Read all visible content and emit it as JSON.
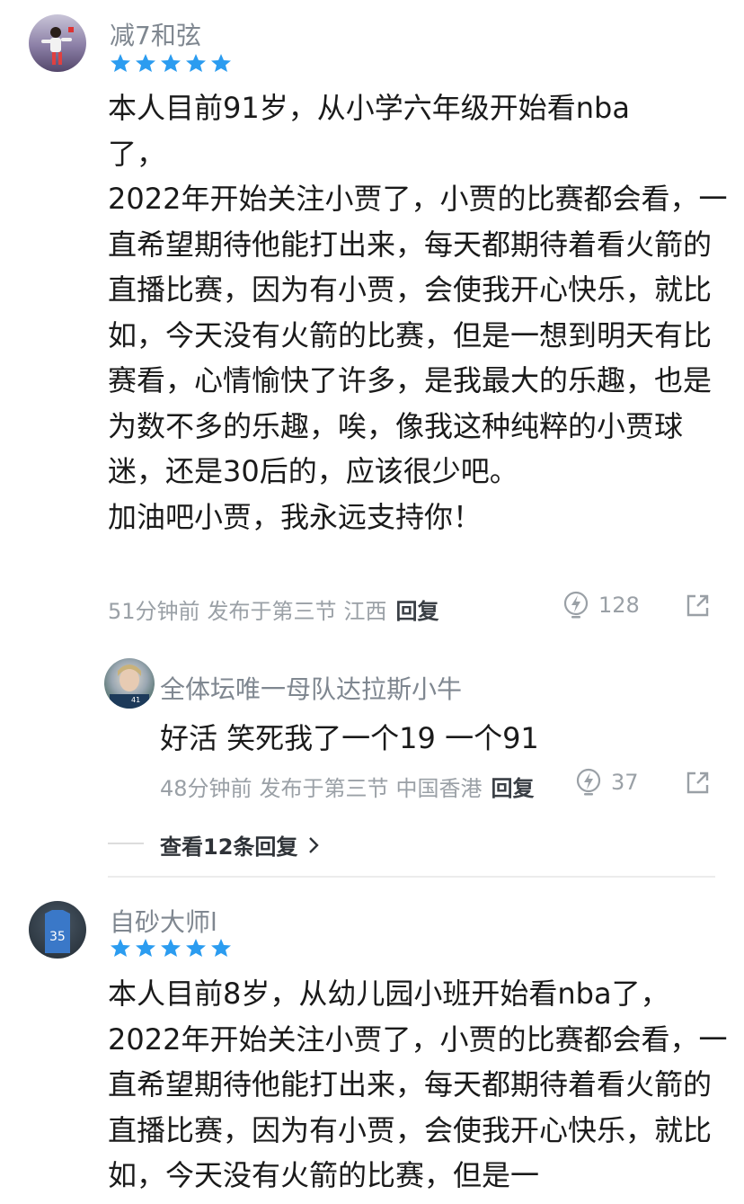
{
  "comments": [
    {
      "username": "减7和弦",
      "stars": 5,
      "paragraphs": [
        "本人目前91岁，从小学六年级开始看nba了，",
        "2022年开始关注小贾了，小贾的比赛都会看，一直希望期待他能打出来，每天都期待着看火箭的直播比赛，因为有小贾，会使我开心快乐，就比如，今天没有火箭的比赛，但是一想到明天有比赛看，心情愉快了许多，是我最大的乐趣，也是为数不多的乐趣，唉，像我这种纯粹的小贾球迷，还是30后的，应该很少吧。",
        "加油吧小贾，我永远支持你！"
      ],
      "time": "51分钟前",
      "posted_in": "发布于第三节",
      "location": "江西",
      "reply_label": "回复",
      "likes": "128"
    },
    {
      "username": "自砂大师l",
      "stars": 5,
      "paragraphs": [
        "本人目前8岁，从幼儿园小班开始看nba了，",
        "2022年开始关注小贾了，小贾的比赛都会看，一直希望期待他能打出来，每天都期待着看火箭的直播比赛，因为有小贾，会使我开心快乐，就比如，今天没有火箭的比赛，但是一"
      ]
    }
  ],
  "reply": {
    "username": "全体坛唯一母队达拉斯小牛",
    "text": "好活 笑死我了一个19 一个91",
    "time": "48分钟前",
    "posted_in": "发布于第三节",
    "location": "中国香港",
    "reply_label": "回复",
    "likes": "37"
  },
  "view_replies": "查看12条回复",
  "colors": {
    "star": "#2b9cf0",
    "meta": "#9aa0a6",
    "username": "#7f8790"
  },
  "icons": [
    "star-icon",
    "like-bolt-icon",
    "share-icon",
    "chevron-right-icon"
  ]
}
